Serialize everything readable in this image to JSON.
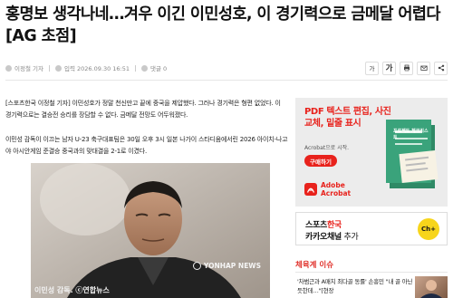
{
  "article": {
    "title": "홍명보 생각나네…겨우 이긴 이민성호, 이 경기력으로 금메달 어렵다 [AG 초점]",
    "reporter": "이정철 기자",
    "date": "입력 2026.09.30 16:51",
    "comments": "댓글 0",
    "tools": {
      "font_small": "가",
      "font_large": "가",
      "print_icon": "print-icon",
      "email_icon": "email-icon",
      "share_icon": "share-icon"
    },
    "paragraphs": [
      "[스포츠한국 이정철 기자] 이민성호가 정말 천신만고 끝에 중국을 제압했다. 그러나 경기력은 형편 없었다. 이 경기력으로는 결승전 승리를 장담할 수 없다. 금메달 전망도 어두워졌다.",
      "이민성 감독이 이끄는 남자 U-23 축구대표팀은 30일 오후 3시 일본 나가이 스타디움에서린 2026 아이치-나고야 아시안게임 준결승 중국과의 맞대결을 2-1로 이겼다."
    ],
    "photo": {
      "watermark": "YONHAP NEWS",
      "caption": "이민성 감독. ⓒ연합뉴스"
    }
  },
  "sidebar": {
    "ad": {
      "title": "PDF 텍스트 편집, 사진 교체, 밑줄 표시",
      "subtitle": "Acrobat으로 시작.",
      "button": "구매하기",
      "brand": "Adobe Acrobat",
      "art_text": "프로젝트 체크리스트"
    },
    "kakao": {
      "brand_black": "스포츠",
      "brand_red": "한국",
      "line2_bold": "카카오채널",
      "line2_rest": " 추가",
      "badge": "Ch+"
    },
    "issues": {
      "heading": "체육계 이슈",
      "items": [
        {
          "text": "'차범근과 A매치 최다골 동률' 손흥민 \"내 골 아닌 듯한데…\"[현장"
        }
      ]
    }
  },
  "colors": {
    "accent": "#e8221c",
    "kakao_yellow": "#f7d51b"
  }
}
